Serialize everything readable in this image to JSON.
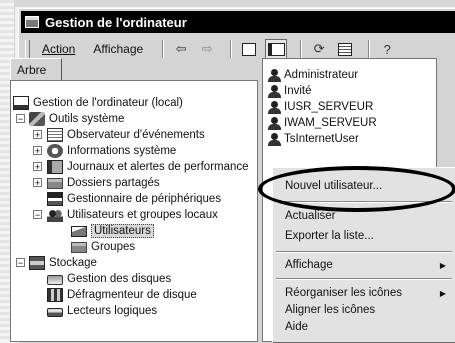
{
  "window": {
    "title": "Gestion de l'ordinateur"
  },
  "menubar": {
    "action": "Action",
    "affichage": "Affichage"
  },
  "toolbar": {
    "icons": [
      "back-arrow-icon",
      "forward-arrow-icon",
      "up-folder-icon",
      "show-tree-icon",
      "refresh-icon",
      "export-list-icon",
      "help-icon"
    ]
  },
  "tree": {
    "tab": "Arbre",
    "nodes": [
      {
        "label": "Gestion de l'ordinateur (local)",
        "icon": "computer-icon"
      },
      {
        "label": "Outils système",
        "icon": "tools-icon"
      },
      {
        "label": "Observateur d'événements",
        "icon": "event-viewer-icon"
      },
      {
        "label": "Informations système",
        "icon": "system-info-icon"
      },
      {
        "label": "Journaux et alertes de performance",
        "icon": "performance-logs-icon"
      },
      {
        "label": "Dossiers partagés",
        "icon": "shared-folders-icon"
      },
      {
        "label": "Gestionnaire de périphériques",
        "icon": "device-manager-icon"
      },
      {
        "label": "Utilisateurs et groupes locaux",
        "icon": "users-groups-icon"
      },
      {
        "label": "Utilisateurs",
        "icon": "open-folder-icon"
      },
      {
        "label": "Groupes",
        "icon": "folder-icon"
      },
      {
        "label": "Stockage",
        "icon": "storage-icon"
      },
      {
        "label": "Gestion des disques",
        "icon": "disk-management-icon"
      },
      {
        "label": "Défragmenteur de disque",
        "icon": "defrag-icon"
      },
      {
        "label": "Lecteurs logiques",
        "icon": "logical-drives-icon"
      }
    ]
  },
  "users": [
    "Administrateur",
    "Invité",
    "IUSR_SERVEUR",
    "IWAM_SERVEUR",
    "TsInternetUser"
  ],
  "context_menu": {
    "nouvel_utilisateur": "Nouvel utilisateur...",
    "actualiser": "Actualiser",
    "exporter": "Exporter la liste...",
    "affichage": "Affichage",
    "reorganiser": "Réorganiser les icônes",
    "aligner": "Aligner les icônes",
    "aide": "Aide"
  }
}
